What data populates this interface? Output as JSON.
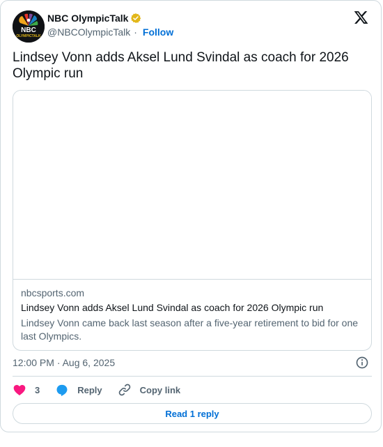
{
  "account": {
    "name": "NBC OlympicTalk",
    "handle": "@NBCOlympicTalk",
    "separator": "·",
    "follow_label": "Follow",
    "avatar_text": "NBC",
    "avatar_subtext": "OLYMPICTALK"
  },
  "tweet": {
    "text": "Lindsey Vonn adds Aksel Lund Svindal as coach for 2026 Olympic run",
    "timestamp": "12:00 PM · Aug 6, 2025"
  },
  "link_card": {
    "domain": "nbcsports.com",
    "title": "Lindsey Vonn adds Aksel Lund Svindal as coach for 2026 Olympic run",
    "description": "Lindsey Vonn came back last season after a five-year retirement to bid for one last Olympics."
  },
  "actions": {
    "like_count": "3",
    "reply_label": "Reply",
    "copy_label": "Copy link"
  },
  "footer": {
    "read_replies_label": "Read 1 reply"
  },
  "colors": {
    "like": "#f91880",
    "reply": "#1d9bf0",
    "link": "#006fd6",
    "verified": "#e2b719"
  },
  "icons": [
    "x-logo-icon",
    "verified-badge-icon",
    "info-icon",
    "heart-icon",
    "reply-bubble-icon",
    "link-icon"
  ]
}
